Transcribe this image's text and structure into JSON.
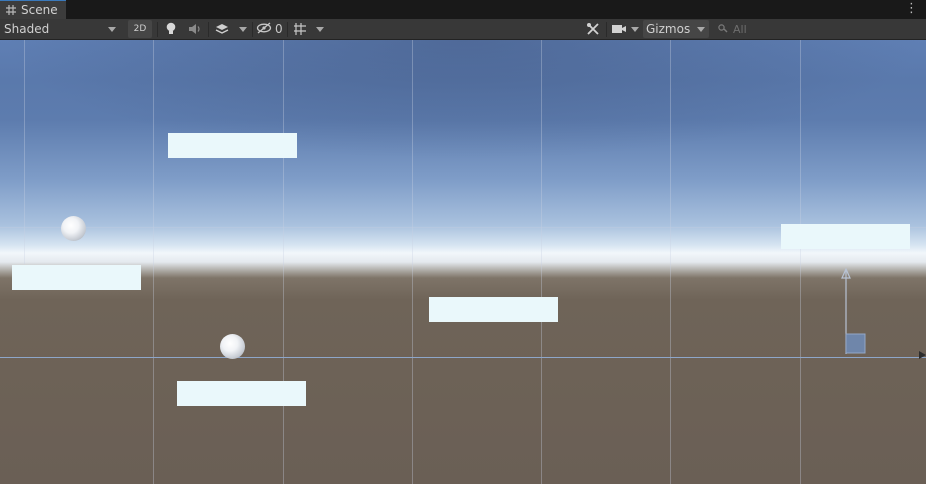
{
  "tab": {
    "title": "Scene",
    "icon": "scene-grid-icon"
  },
  "toolbar": {
    "draw_mode": "Shaded",
    "mode_2d_label": "2D",
    "hidden_count": "0",
    "gizmos_label": "Gizmos",
    "search_placeholder": "All"
  },
  "icons": {
    "lighting": "lightbulb-icon",
    "audio": "speaker-icon",
    "effects": "effects-stack-icon",
    "visibility": "eye-slash-icon",
    "grid": "grid-snap-icon",
    "tools": "tools-icon",
    "camera": "camera-icon",
    "search": "search-icon",
    "menu": "kebab-menu-icon"
  },
  "colors": {
    "accent": "#3a79bb",
    "platform": "#eaf8fb",
    "ground": "#6a5f55",
    "sky": "#5a79ac"
  },
  "scene": {
    "objects": [
      {
        "name": "platform"
      },
      {
        "name": "platform"
      },
      {
        "name": "platform"
      },
      {
        "name": "platform"
      },
      {
        "name": "platform"
      },
      {
        "name": "ball"
      },
      {
        "name": "ball"
      }
    ]
  }
}
